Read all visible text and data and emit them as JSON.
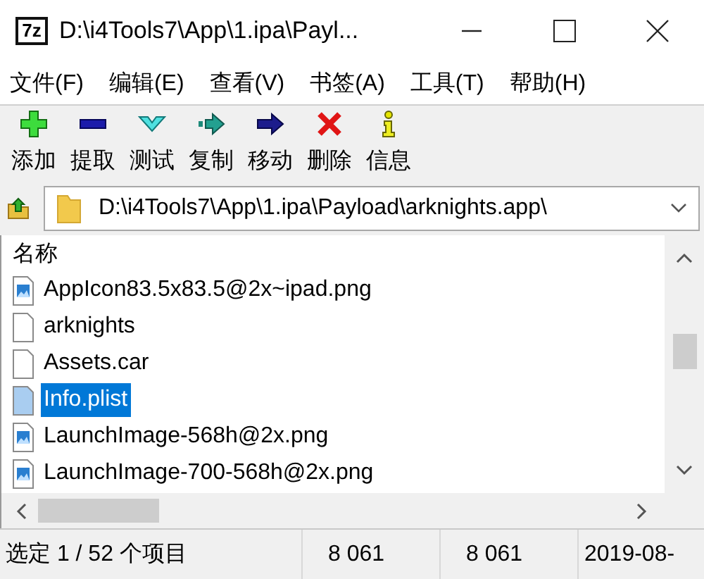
{
  "window": {
    "app_logo": "7z",
    "title": "D:\\i4Tools7\\App\\1.ipa\\Payl..."
  },
  "menu": [
    "文件(F)",
    "编辑(E)",
    "查看(V)",
    "书签(A)",
    "工具(T)",
    "帮助(H)"
  ],
  "toolbar": [
    {
      "kind": "add",
      "label": "添加"
    },
    {
      "kind": "extract",
      "label": "提取"
    },
    {
      "kind": "test",
      "label": "测试"
    },
    {
      "kind": "copy",
      "label": "复制"
    },
    {
      "kind": "move",
      "label": "移动"
    },
    {
      "kind": "delete",
      "label": "删除"
    },
    {
      "kind": "info",
      "label": "信息"
    }
  ],
  "address_bar": {
    "path": "D:\\i4Tools7\\App\\1.ipa\\Payload\\arknights.app\\"
  },
  "file_list": {
    "columns": [
      "名称"
    ],
    "rows": [
      {
        "name": "AppIcon83.5x83.5@2x~ipad.png",
        "kind": "image",
        "selected": false
      },
      {
        "name": "arknights",
        "kind": "file",
        "selected": false
      },
      {
        "name": "Assets.car",
        "kind": "file",
        "selected": false
      },
      {
        "name": "Info.plist",
        "kind": "file",
        "selected": true
      },
      {
        "name": "LaunchImage-568h@2x.png",
        "kind": "image",
        "selected": false
      },
      {
        "name": "LaunchImage-700-568h@2x.png",
        "kind": "image",
        "selected": false
      }
    ]
  },
  "status_bar": [
    "选定 1 / 52 个项目",
    "8 061",
    "8 061",
    "2019-08-"
  ]
}
